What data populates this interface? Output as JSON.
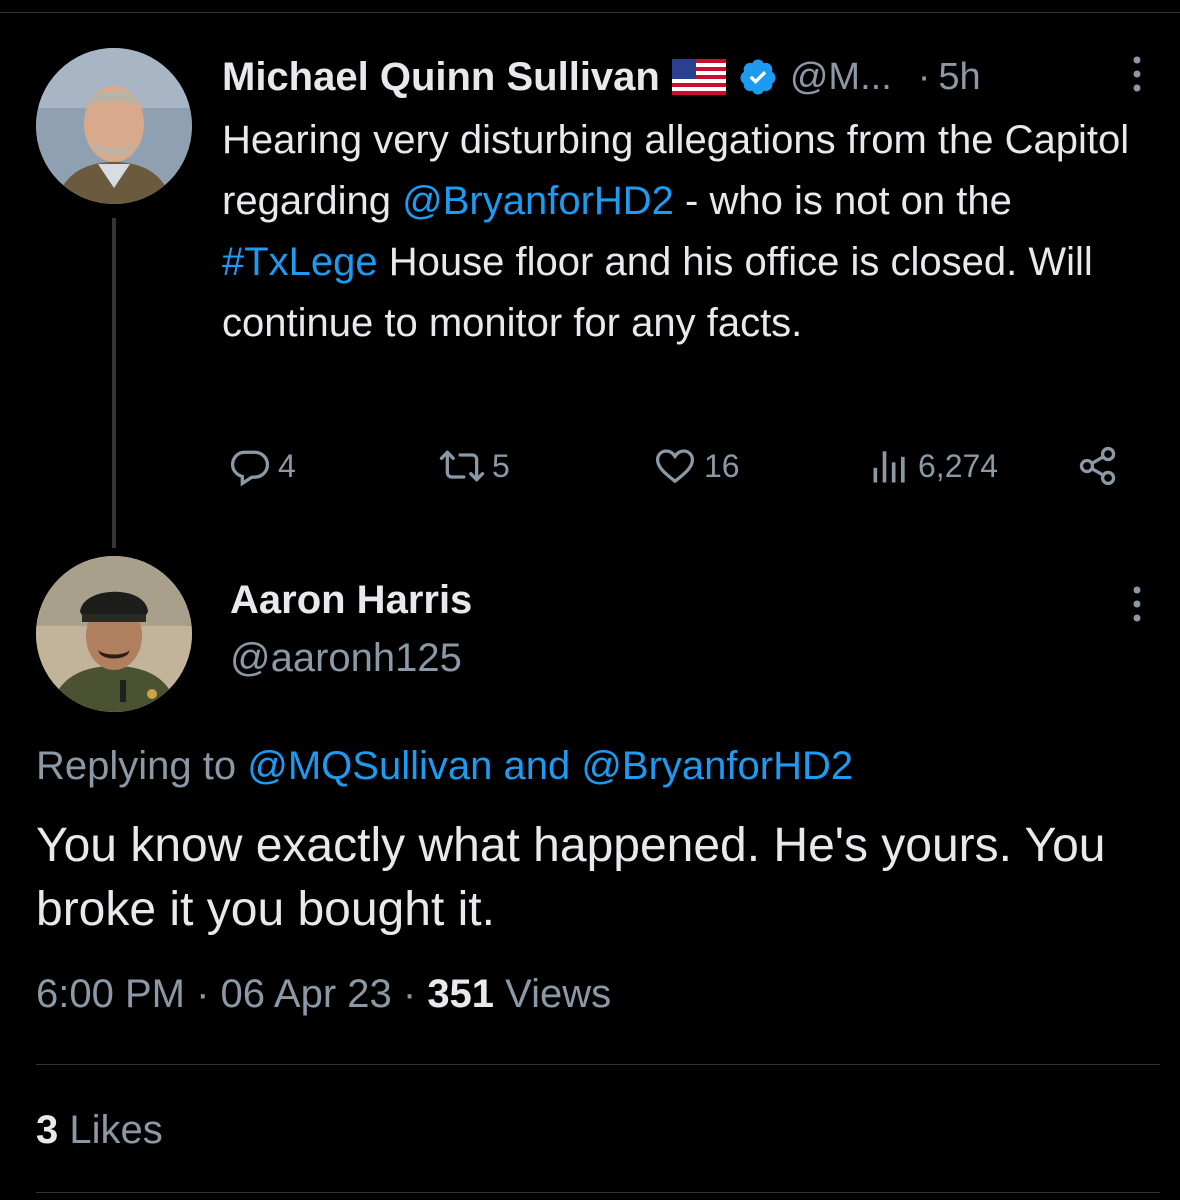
{
  "parent_tweet": {
    "author_name": "Michael Quinn Sullivan",
    "flag_icon": "us-flag-icon",
    "verified_icon": "verified-badge-icon",
    "handle_truncated": "@M...",
    "separator": "·",
    "time_ago": "5h",
    "body_parts": {
      "p1": "Hearing very disturbing allegations from the Capitol regarding ",
      "mention": "@BryanforHD2",
      "p2": " - who is not on the ",
      "hashtag": "#TxLege",
      "p3": " House floor and his office is closed. Will continue to monitor for any facts."
    },
    "actions": {
      "replies": "4",
      "retweets": "5",
      "likes": "16",
      "views": "6,274"
    }
  },
  "reply_tweet": {
    "author_name": "Aaron Harris",
    "handle": "@aaronh125",
    "replying_label": "Replying to ",
    "replying_mentions": "@MQSullivan and @BryanforHD2",
    "body": "You know exactly what happened. He's yours. You broke it you bought it.",
    "time": "6:00 PM",
    "date": "06 Apr 23",
    "views_count": "351",
    "views_label": " Views",
    "likes_count": "3",
    "likes_label": " Likes"
  },
  "colors": {
    "background": "#000000",
    "text": "#e7e9ea",
    "secondary": "#8b98a5",
    "link": "#1d9bf0",
    "divider": "#2f3336"
  }
}
